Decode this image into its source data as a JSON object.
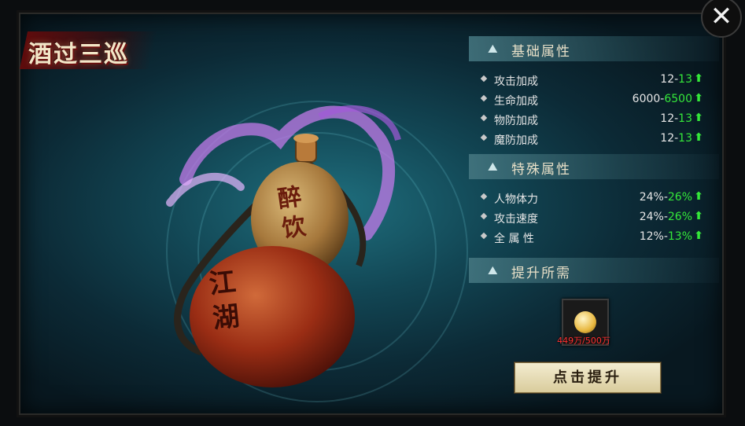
{
  "window": {
    "title": "酒过三巡",
    "close_glyph": "✕"
  },
  "gourd": {
    "upper_text": "醉饮",
    "lower_text": "江湖"
  },
  "sections": {
    "basic": {
      "label": "基础属性",
      "rows": [
        {
          "name": "攻击加成",
          "old": "12-",
          "new": "13"
        },
        {
          "name": "生命加成",
          "old": "6000-",
          "new": "6500"
        },
        {
          "name": "物防加成",
          "old": "12-",
          "new": "13"
        },
        {
          "name": "魔防加成",
          "old": "12-",
          "new": "13"
        }
      ]
    },
    "special": {
      "label": "特殊属性",
      "rows": [
        {
          "name": "人物体力",
          "old": "24%-",
          "new": "26%"
        },
        {
          "name": "攻击速度",
          "old": "24%-",
          "new": "26%"
        },
        {
          "name": "全 属 性",
          "old": "12%-",
          "new": "13%"
        }
      ]
    },
    "requirement": {
      "label": "提升所需",
      "item_count": "449万/500万"
    }
  },
  "upgrade_button": {
    "label": "点击提升"
  },
  "colors": {
    "increase": "#35e83a",
    "shortage": "#ff3030",
    "accent": "#1f6f7e"
  }
}
